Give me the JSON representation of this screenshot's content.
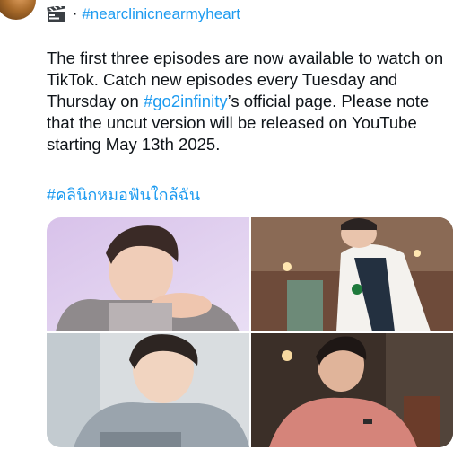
{
  "post": {
    "hashtag_header": "#nearclinicnearmyheart",
    "separator": "·",
    "body_part1": "The first three episodes are now available to watch on TikTok. Catch new episodes every Tuesday and Thursday on ",
    "mention": "#go2infinity",
    "body_part2": "’s official page. Please note that the uncut version will be released on YouTube starting May 13th 2025.",
    "thai_hashtag": "#คลินิกหมอฟันใกล้ฉัน"
  },
  "icons": {
    "header_icon": "clapper-board-icon"
  },
  "colors": {
    "link": "#1d9bf0",
    "text": "#0f1419"
  }
}
